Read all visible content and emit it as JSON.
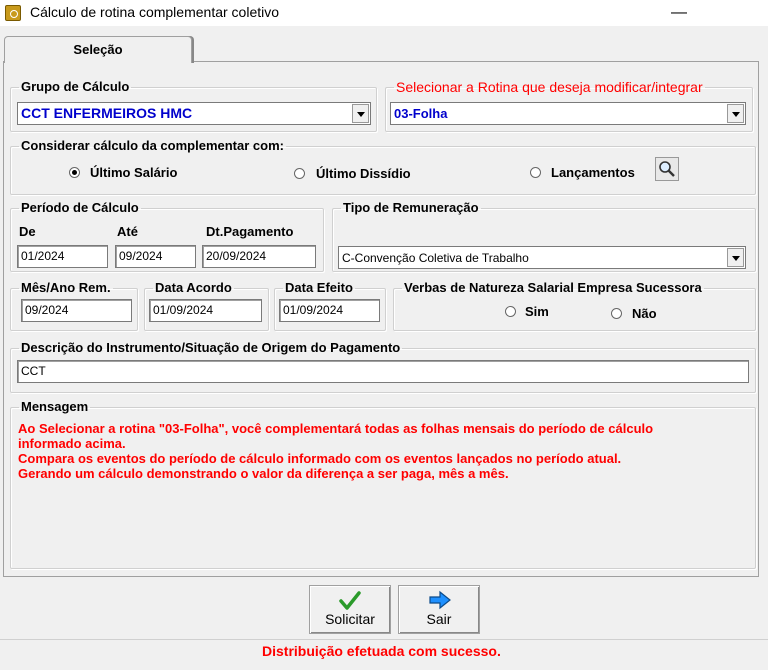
{
  "window": {
    "title": "Cálculo de rotina complementar coletivo",
    "minimize": "—",
    "maximize": "☐",
    "close": "✕"
  },
  "tab": {
    "label": "Seleção"
  },
  "grupo_calculo": {
    "legend": "Grupo de Cálculo",
    "value": "CCT ENFERMEIROS HMC"
  },
  "rotina": {
    "legend": "Selecionar a Rotina que deseja modificar/integrar",
    "value": "03-Folha"
  },
  "considerar": {
    "legend": "Considerar cálculo da complementar com:",
    "options": [
      "Último Salário",
      "Último Dissídio",
      "Lançamentos"
    ],
    "selected": "Último Salário"
  },
  "periodo": {
    "legend": "Período de Cálculo",
    "de_label": "De",
    "de_value": "01/2024",
    "ate_label": "Até",
    "ate_value": "09/2024",
    "dtpag_label": "Dt.Pagamento",
    "dtpag_value": "20/09/2024"
  },
  "tipo_remuneracao": {
    "legend": "Tipo de Remuneração",
    "value": "C-Convenção Coletiva de Trabalho"
  },
  "mes_ano_rem": {
    "legend": "Mês/Ano Rem.",
    "value": "09/2024"
  },
  "data_acordo": {
    "legend": "Data Acordo",
    "value": "01/09/2024"
  },
  "data_efeito": {
    "legend": "Data Efeito",
    "value": "01/09/2024"
  },
  "verbas": {
    "legend": "Verbas de Natureza Salarial Empresa Sucessora",
    "options": [
      "Sim",
      "Não"
    ]
  },
  "descricao": {
    "legend": "Descrição do Instrumento/Situação de Origem do Pagamento",
    "value": "CCT"
  },
  "mensagem": {
    "legend": "Mensagem",
    "lines": [
      "Ao Selecionar a rotina \"03-Folha\", você complementará todas as folhas mensais do período de cálculo",
      "informado acima.",
      "Compara os eventos do período de cálculo informado com os eventos lançados no período atual.",
      "Gerando um cálculo demonstrando o valor da diferença a ser paga, mês a mês."
    ]
  },
  "buttons": {
    "solicitar": "Solicitar",
    "sair": "Sair"
  },
  "status": {
    "text": "Distribuição efetuada com sucesso."
  },
  "colors": {
    "accent_red": "#ff0000",
    "combo_blue": "#0000cc",
    "check_green": "#2a9a2a",
    "arrow_blue": "#1e90ff"
  }
}
